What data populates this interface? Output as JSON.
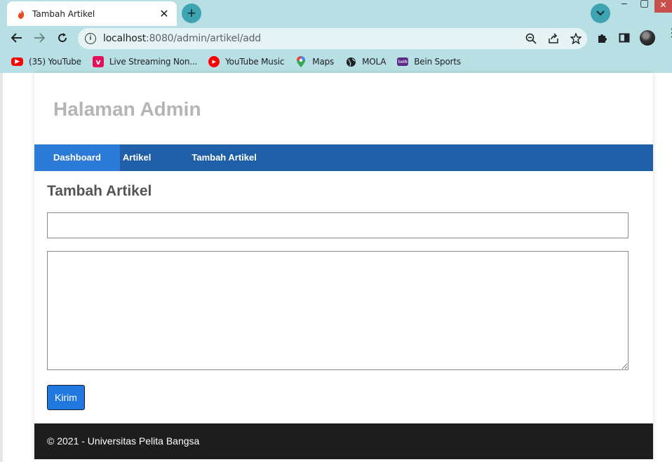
{
  "browser": {
    "tab": {
      "title": "Tambah Artikel",
      "close": "✕"
    },
    "newtab": "+",
    "address": {
      "host": "localhost",
      "path": ":8080/admin/artikel/add"
    },
    "bookmarks": [
      {
        "label": "(35) YouTube",
        "icon": "youtube-icon",
        "color": "#ff0000"
      },
      {
        "label": "Live Streaming Non...",
        "icon": "vidio-icon",
        "color": "#e4105a"
      },
      {
        "label": "YouTube Music",
        "icon": "youtube-music-icon",
        "color": "#ff0000"
      },
      {
        "label": "Maps",
        "icon": "maps-icon",
        "color": "#34a853"
      },
      {
        "label": "MOLA",
        "icon": "globe-icon",
        "color": "#202124"
      },
      {
        "label": "Bein Sports",
        "icon": "bein-icon",
        "color": "#5b2a86"
      }
    ]
  },
  "site": {
    "title": "Halaman Admin",
    "nav": [
      {
        "label": "Dashboard",
        "active": true
      },
      {
        "label": "Artikel",
        "active": false
      },
      {
        "label": "Tambah Artikel",
        "active": false
      }
    ]
  },
  "form": {
    "heading": "Tambah Artikel",
    "title_value": "",
    "body_value": "",
    "submit_label": "Kirim"
  },
  "footer": {
    "text": "© 2021 - Universitas Pelita Bangsa"
  },
  "colors": {
    "chrome": "#b8dfe4",
    "nav": "#1f5fa8",
    "nav_active": "#2b7ad8",
    "button": "#2077dd",
    "footer": "#1d1d1d"
  }
}
